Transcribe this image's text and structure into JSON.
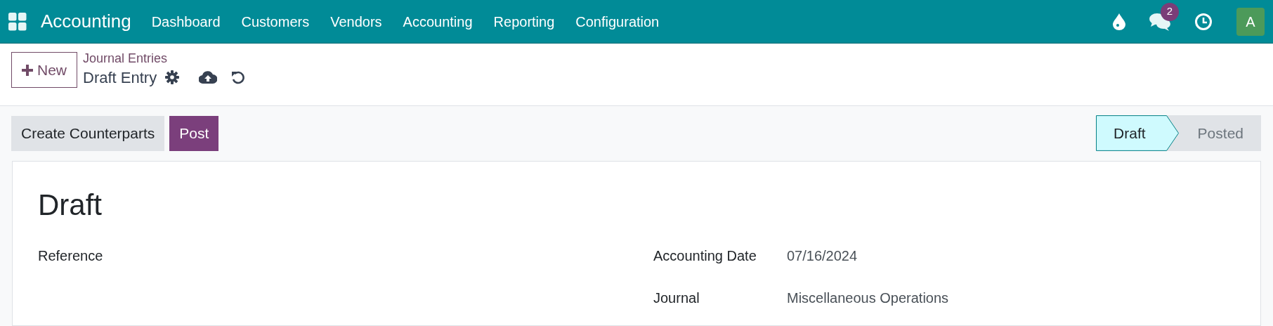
{
  "navbar": {
    "app_name": "Accounting",
    "menu": [
      {
        "label": "Dashboard"
      },
      {
        "label": "Customers"
      },
      {
        "label": "Vendors"
      },
      {
        "label": "Accounting"
      },
      {
        "label": "Reporting"
      },
      {
        "label": "Configuration"
      }
    ],
    "messages_count": "2",
    "avatar": "A"
  },
  "control_panel": {
    "new_button": "New",
    "breadcrumb": "Journal Entries",
    "record_name": "Draft Entry"
  },
  "actions": [
    {
      "label": "Create Counterparts",
      "kind": "secondary"
    },
    {
      "label": "Post",
      "kind": "primary"
    }
  ],
  "status_bar": [
    {
      "label": "Draft",
      "selected": true
    },
    {
      "label": "Posted",
      "selected": false
    }
  ],
  "form": {
    "title": "Draft",
    "left_fields": [
      {
        "label": "Reference"
      }
    ],
    "right_fields": [
      {
        "label": "Accounting Date",
        "value": "07/16/2024"
      },
      {
        "label": "Journal",
        "value": "Miscellaneous Operations"
      }
    ]
  }
}
